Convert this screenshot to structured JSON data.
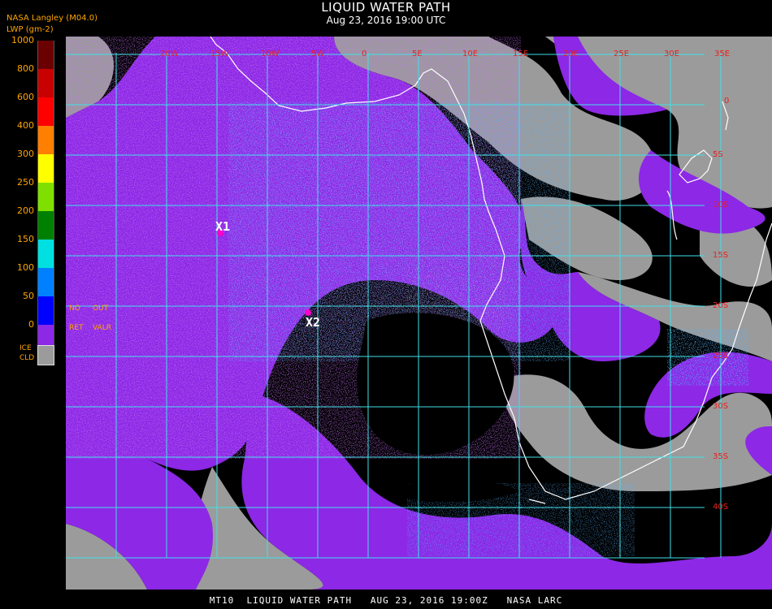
{
  "title": "LIQUID WATER PATH",
  "datetime": "Aug 23, 2016 19:00 UTC",
  "header": {
    "product": "NASA Langley (M04.0)",
    "units": "LWP (gm-2)"
  },
  "legend": {
    "ticks": [
      "1000",
      "800",
      "600",
      "400",
      "300",
      "250",
      "200",
      "150",
      "100",
      "50",
      "0"
    ],
    "colors": [
      "#6b0000",
      "#c80000",
      "#ff0000",
      "#ff7f00",
      "#ffff00",
      "#7fe000",
      "#008000",
      "#00e0e0",
      "#0080ff",
      "#0000ff",
      "#8c28e6"
    ],
    "no_ret": [
      "NO",
      "RET"
    ],
    "out_valr": [
      "OUT",
      "VALR"
    ],
    "ice_cld": [
      "ICE",
      "CLD"
    ],
    "ice_color": "#9b9b9b"
  },
  "grid": {
    "lon_labels": [
      "20W",
      "15W",
      "10W",
      "5W",
      "0",
      "5E",
      "10E",
      "15E",
      "20E",
      "25E",
      "30E",
      "35E"
    ],
    "lat_labels": [
      "0",
      "5S",
      "10S",
      "15S",
      "20S",
      "25S",
      "30S",
      "35S",
      "40S"
    ],
    "line_color": "#40e0e8",
    "label_color": "#e8201e"
  },
  "markers": [
    {
      "label": "X1",
      "color": "#ff00c8"
    },
    {
      "label": "X2",
      "color": "#ff00c8"
    }
  ],
  "footer": "MT10  LIQUID WATER PATH   AUG 23, 2016 19:00Z   NASA LARC",
  "colors": {
    "clear": "#000000",
    "low_lwp": "#8c28e6",
    "ice": "#9b9b9b",
    "coast": "#ffffff"
  }
}
